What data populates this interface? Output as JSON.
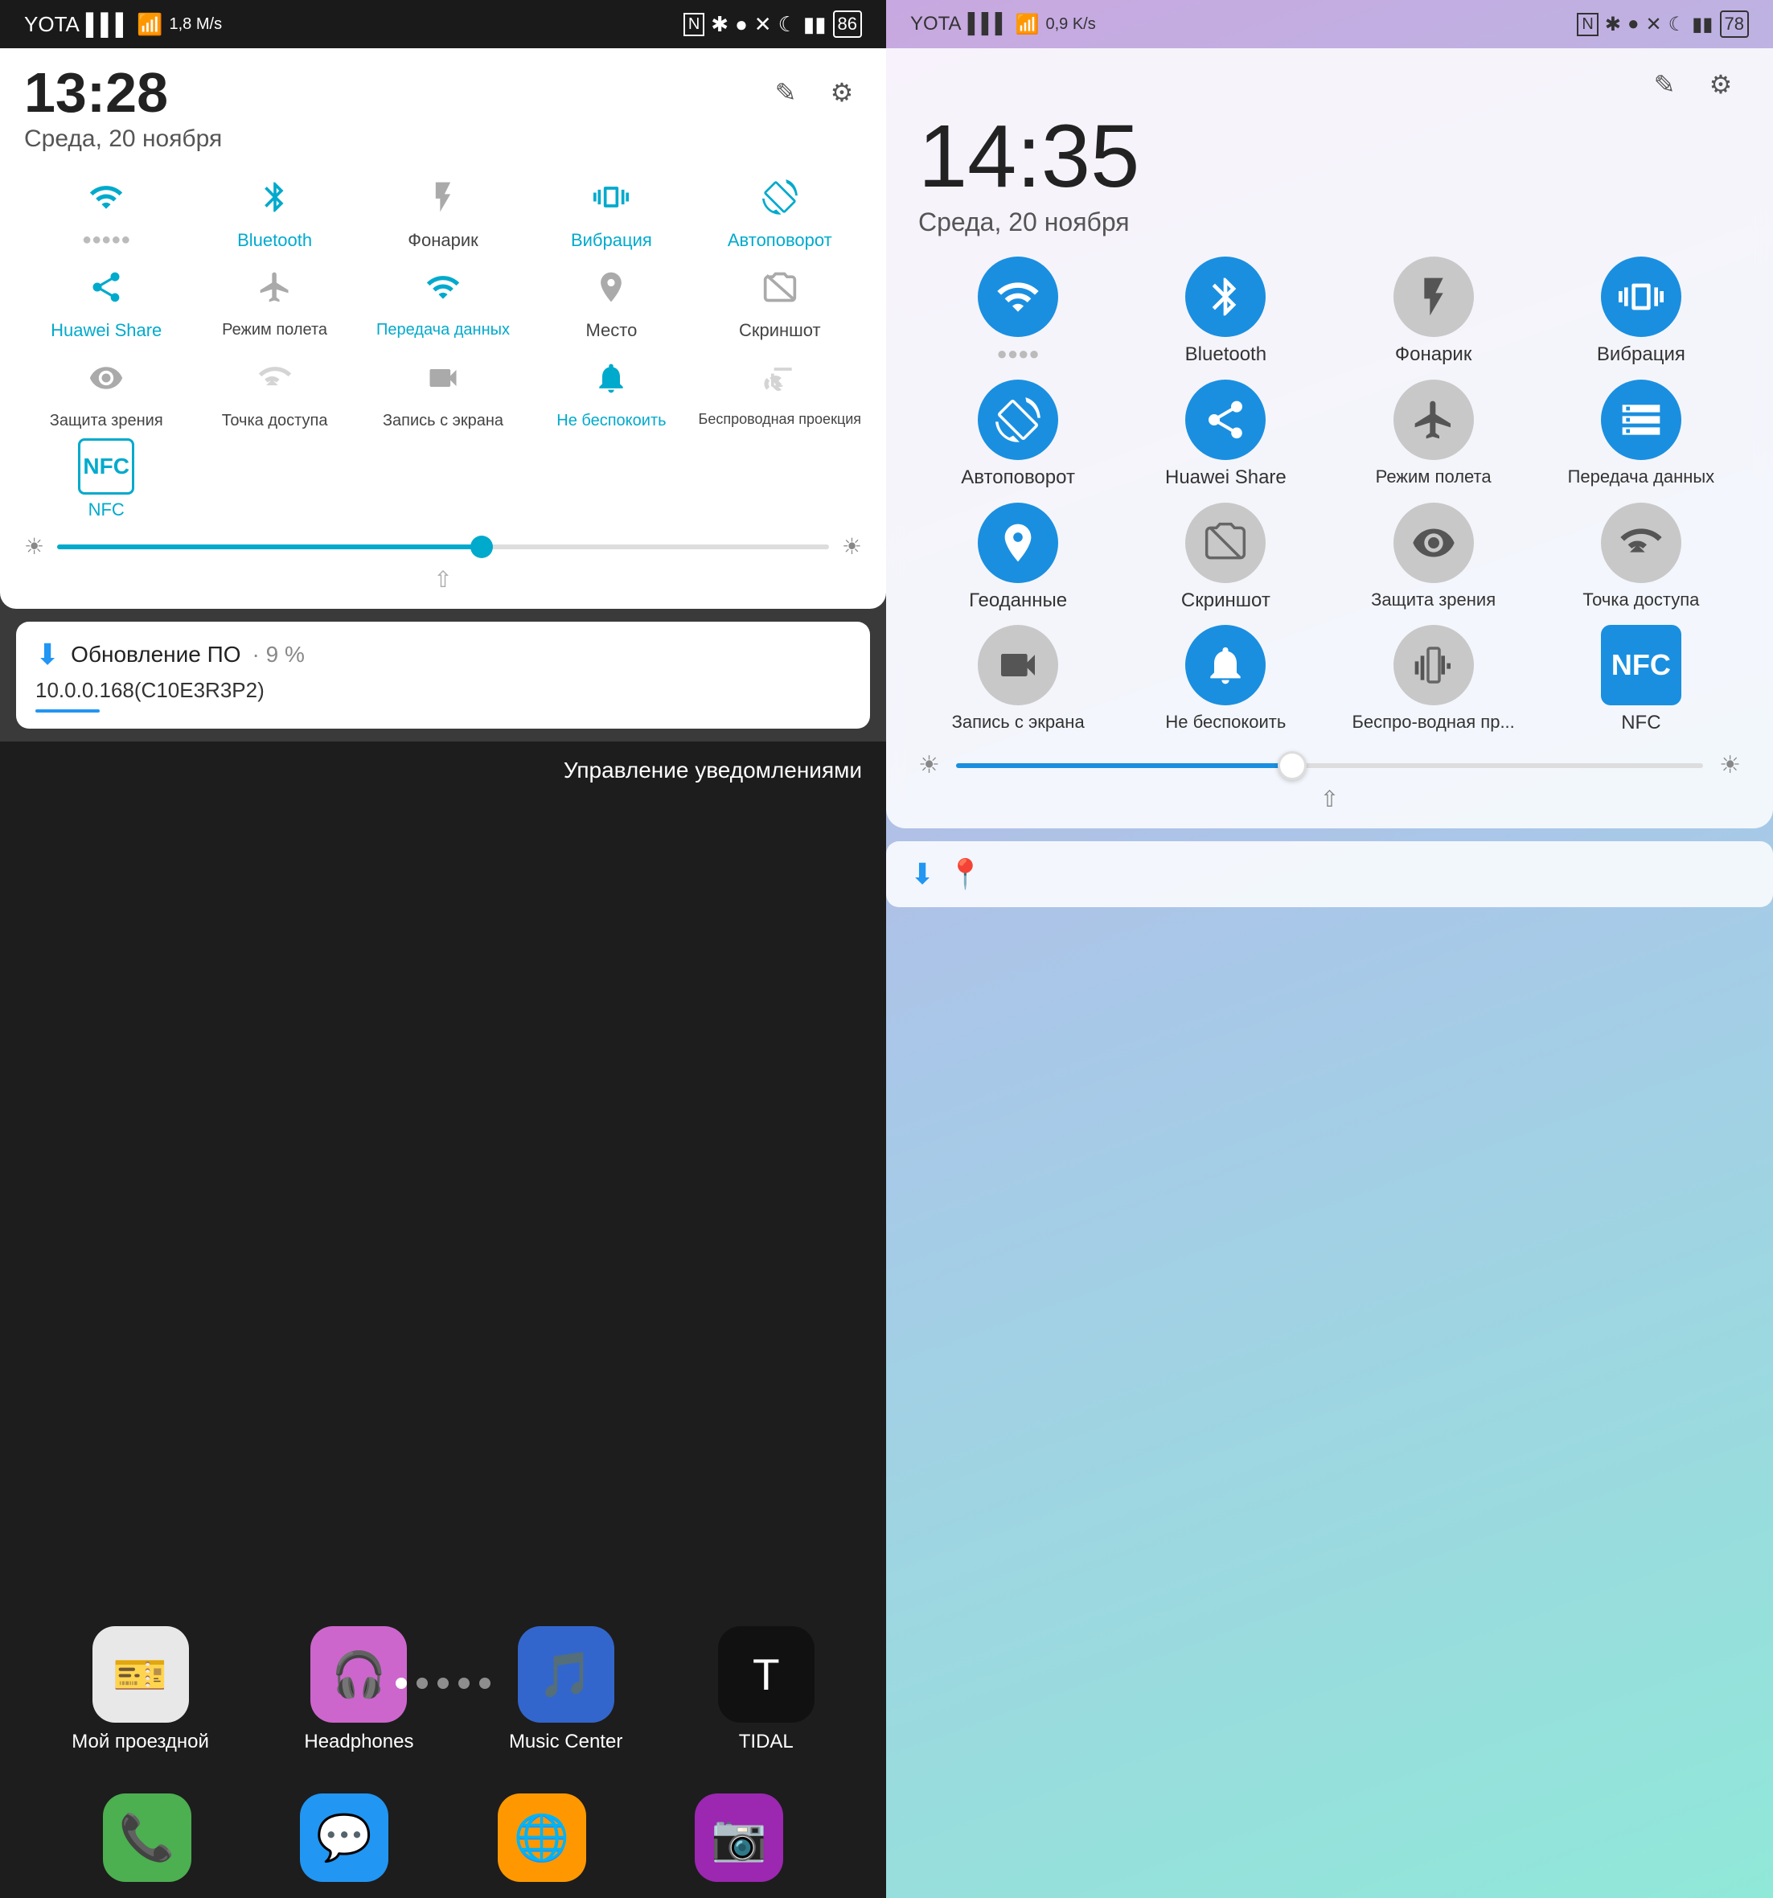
{
  "left": {
    "statusBar": {
      "carrier": "YOTA",
      "signal": "▌▌▌",
      "wifi": "WiFi",
      "speed": "1,8 M/s",
      "nfc": "N",
      "bluetooth": "🔷",
      "alarm": "🔔",
      "mute": "✖",
      "moon": "🌙",
      "battery_icon": "battery",
      "battery": "86"
    },
    "time": "13:28",
    "date": "Среда, 20 ноября",
    "tiles": [
      {
        "label": "WiFi",
        "active": true,
        "sublabel": ""
      },
      {
        "label": "Bluetooth",
        "active": true,
        "sublabel": ""
      },
      {
        "label": "Фонарик",
        "active": false,
        "sublabel": ""
      },
      {
        "label": "Вибрация",
        "active": true,
        "sublabel": ""
      },
      {
        "label": "Автоповорот",
        "active": true,
        "sublabel": ""
      },
      {
        "label": "Huawei Share",
        "active": true,
        "sublabel": ""
      },
      {
        "label": "Режим полета",
        "active": false,
        "sublabel": ""
      },
      {
        "label": "Передача данных",
        "active": true,
        "sublabel": ""
      },
      {
        "label": "Место",
        "active": false,
        "sublabel": ""
      },
      {
        "label": "Скриншот",
        "active": false,
        "sublabel": ""
      },
      {
        "label": "Защита зрения",
        "active": false,
        "sublabel": ""
      },
      {
        "label": "Точка доступа",
        "active": false,
        "sublabel": ""
      },
      {
        "label": "Запись с экрана",
        "active": false,
        "sublabel": ""
      },
      {
        "label": "Не беспокоить",
        "active": true,
        "sublabel": ""
      },
      {
        "label": "Беспроводная проекция",
        "active": false,
        "sublabel": ""
      },
      {
        "label": "NFC",
        "active": true,
        "sublabel": ""
      }
    ],
    "brightness": 55,
    "notification": {
      "title": "Обновление ПО",
      "percent": "9 %",
      "subtitle": "10.0.0.168(C10E3R3P2)"
    },
    "manage_label": "Управление уведомлениями",
    "apps": [
      {
        "label": "Мой проездной",
        "color": "#e8f0fe",
        "icon": "🎫"
      },
      {
        "label": "Headphones",
        "color": "#f0e0ff",
        "icon": "🎧"
      },
      {
        "label": "Music Center",
        "color": "#e0f0ff",
        "icon": "🎵"
      },
      {
        "label": "TIDAL",
        "color": "#000",
        "icon": "T"
      }
    ],
    "dock": [
      {
        "icon": "📞",
        "color": "#4CAF50"
      },
      {
        "icon": "💬",
        "color": "#2196F3"
      },
      {
        "icon": "🌐",
        "color": "#FF9800"
      },
      {
        "icon": "📷",
        "color": "#9C27B0"
      }
    ]
  },
  "right": {
    "statusBar": {
      "carrier": "YOTA",
      "speed": "0,9 K/s",
      "battery": "78"
    },
    "time": "14:35",
    "date": "Среда, 20 ноября",
    "tiles": [
      {
        "label": "WiFi",
        "active": true
      },
      {
        "label": "Bluetooth",
        "active": true
      },
      {
        "label": "Фонарик",
        "active": false
      },
      {
        "label": "Вибрация",
        "active": true
      },
      {
        "label": "Автоповорот",
        "active": true
      },
      {
        "label": "Huawei Share",
        "active": true
      },
      {
        "label": "Режим полета",
        "active": false
      },
      {
        "label": "Передача данных",
        "active": true
      },
      {
        "label": "Геоданные",
        "active": true
      },
      {
        "label": "Скриншот",
        "active": false
      },
      {
        "label": "Защита зрения",
        "active": false
      },
      {
        "label": "Точка доступа",
        "active": false
      },
      {
        "label": "Запись с экрана",
        "active": false
      },
      {
        "label": "Не беспокоить",
        "active": true
      },
      {
        "label": "Беспро-водная пр...",
        "active": false
      },
      {
        "label": "NFC",
        "active": true
      }
    ],
    "brightness": 45,
    "notification_icon": "⬇",
    "notification_geo": "📍"
  }
}
